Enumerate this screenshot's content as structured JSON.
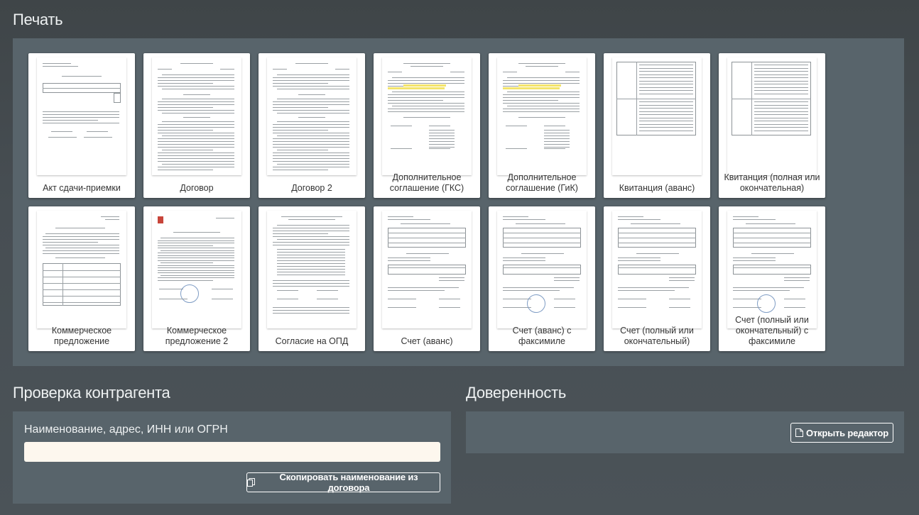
{
  "print": {
    "title": "Печать",
    "documents": [
      {
        "label": "Акт сдачи-приемки",
        "thumb": "act"
      },
      {
        "label": "Договор",
        "thumb": "contract"
      },
      {
        "label": "Договор 2",
        "thumb": "contract"
      },
      {
        "label": "Дополнительное соглашение (ГКС)",
        "thumb": "addendum"
      },
      {
        "label": "Дополнительное соглашение (ГиК)",
        "thumb": "addendum"
      },
      {
        "label": "Квитанция (аванс)",
        "thumb": "receipt"
      },
      {
        "label": "Квитанция (полная или окончательная)",
        "thumb": "receipt"
      },
      {
        "label": "Коммерческое предложение",
        "thumb": "offer"
      },
      {
        "label": "Коммерческое предложение 2",
        "thumb": "offer2"
      },
      {
        "label": "Согласие на ОПД",
        "thumb": "consent"
      },
      {
        "label": "Счет (аванс)",
        "thumb": "invoice"
      },
      {
        "label": "Счет (аванс) с факсимиле",
        "thumb": "invoice-seal"
      },
      {
        "label": "Счет (полный или окончательный)",
        "thumb": "invoice"
      },
      {
        "label": "Счет (полный или окончательный) с факсимиле",
        "thumb": "invoice-seal"
      }
    ]
  },
  "counterparty": {
    "title": "Проверка контрагента",
    "field_label": "Наименование, адрес, ИНН или ОГРН",
    "input_value": "",
    "copy_button": "Скопировать наименование из договора"
  },
  "proxy": {
    "title": "Доверенность",
    "open_editor_button": "Открыть редактор"
  },
  "icons": {
    "copy": "copy-icon",
    "file": "file-icon"
  }
}
